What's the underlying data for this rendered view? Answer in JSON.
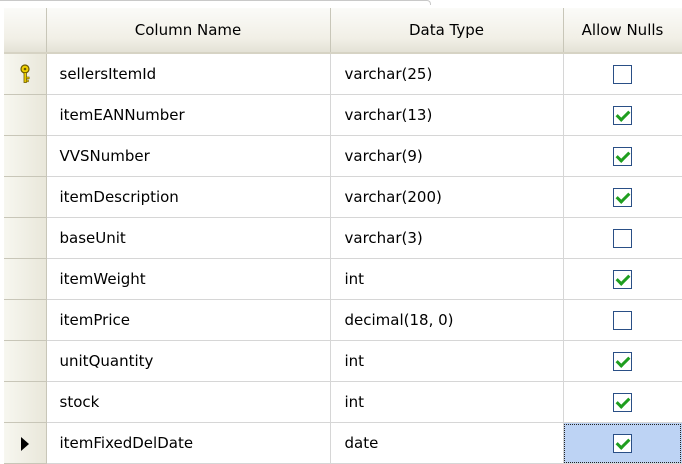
{
  "columns_header": {
    "column_name": "Column Name",
    "data_type": "Data Type",
    "allow_nulls": "Allow Nulls"
  },
  "rows": [
    {
      "name": "sellersItemId",
      "type": "varchar(25)",
      "allow_nulls": false,
      "indicator": "primary-key"
    },
    {
      "name": "itemEANNumber",
      "type": "varchar(13)",
      "allow_nulls": true,
      "indicator": ""
    },
    {
      "name": "VVSNumber",
      "type": "varchar(9)",
      "allow_nulls": true,
      "indicator": ""
    },
    {
      "name": "itemDescription",
      "type": "varchar(200)",
      "allow_nulls": true,
      "indicator": ""
    },
    {
      "name": "baseUnit",
      "type": "varchar(3)",
      "allow_nulls": false,
      "indicator": ""
    },
    {
      "name": "itemWeight",
      "type": "int",
      "allow_nulls": true,
      "indicator": ""
    },
    {
      "name": "itemPrice",
      "type": "decimal(18, 0)",
      "allow_nulls": false,
      "indicator": ""
    },
    {
      "name": "unitQuantity",
      "type": "int",
      "allow_nulls": true,
      "indicator": ""
    },
    {
      "name": "stock",
      "type": "int",
      "allow_nulls": true,
      "indicator": ""
    },
    {
      "name": "itemFixedDelDate",
      "type": "date",
      "allow_nulls": true,
      "indicator": "current-row"
    }
  ],
  "colors": {
    "active_cell": "#bdd3f4",
    "check": "#1f9e1f",
    "checkbox_border": "#2a4f86"
  }
}
